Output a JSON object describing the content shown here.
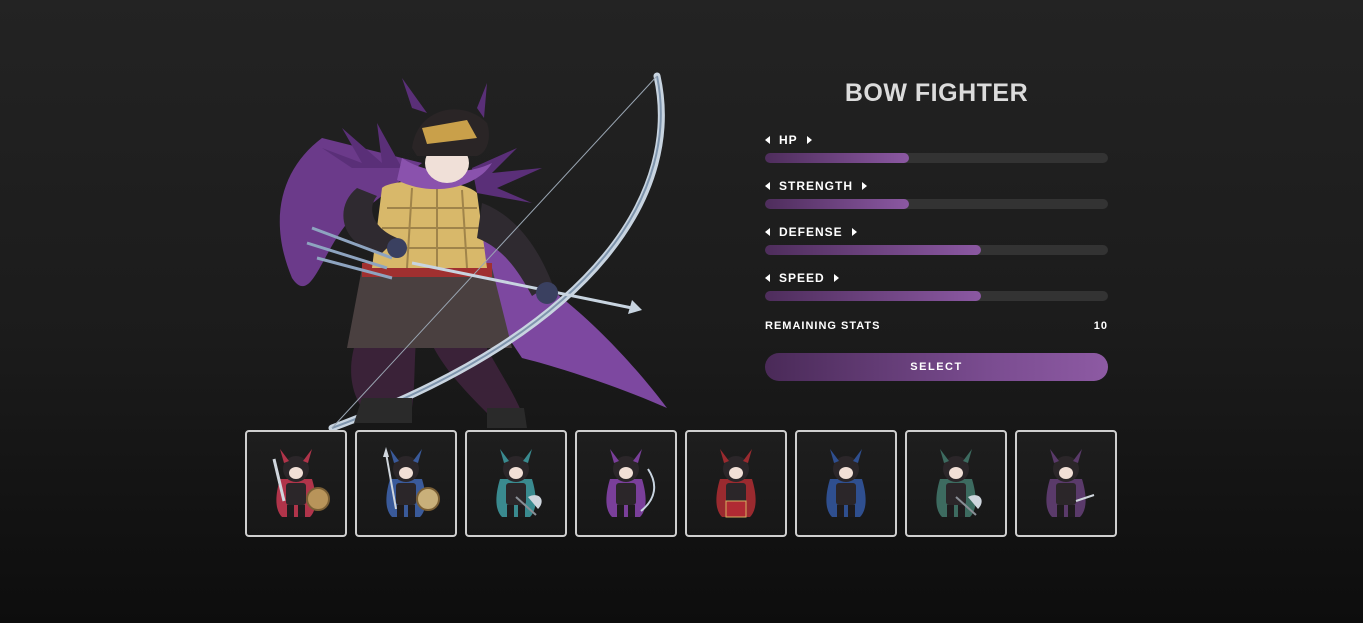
{
  "character": {
    "name": "BOW FIGHTER"
  },
  "stats": [
    {
      "label": "HP",
      "value": 0.42
    },
    {
      "label": "STRENGTH",
      "value": 0.42
    },
    {
      "label": "DEFENSE",
      "value": 0.63
    },
    {
      "label": "SPEED",
      "value": 0.63
    }
  ],
  "remaining": {
    "label": "REMAINING STATS",
    "value": "10"
  },
  "select_label": "SELECT",
  "roster": [
    {
      "name": "sword-shield-knight",
      "cape": "#b0344a",
      "weapon": "sword"
    },
    {
      "name": "spear-knight",
      "cape": "#3a5a9a",
      "weapon": "spear"
    },
    {
      "name": "axe-knight",
      "cape": "#3a8a8f",
      "weapon": "axe"
    },
    {
      "name": "bow-fighter",
      "cape": "#7a3f9a",
      "weapon": "bow"
    },
    {
      "name": "red-mage",
      "cape": "#9a2a2f",
      "weapon": "book"
    },
    {
      "name": "blue-mage",
      "cape": "#2f4f8f",
      "weapon": "none"
    },
    {
      "name": "heavy-axe-knight",
      "cape": "#3d6b60",
      "weapon": "axe"
    },
    {
      "name": "hooded-rogue",
      "cape": "#5a3a6a",
      "weapon": "dagger"
    }
  ],
  "colors": {
    "accent": "#8b58a2",
    "accent_dark": "#4e2d5c",
    "bar_track": "#333333"
  }
}
